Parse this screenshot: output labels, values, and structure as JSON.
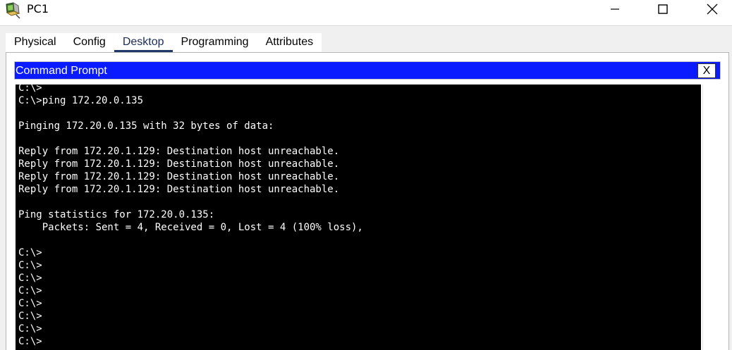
{
  "window": {
    "title": "PC1",
    "icon": "pc-app-icon",
    "controls": [
      "minimize-icon",
      "maximize-icon",
      "close-icon"
    ]
  },
  "tabs": [
    {
      "label": "Physical",
      "active": false
    },
    {
      "label": "Config",
      "active": false
    },
    {
      "label": "Desktop",
      "active": true
    },
    {
      "label": "Programming",
      "active": false
    },
    {
      "label": "Attributes",
      "active": false
    }
  ],
  "command_prompt": {
    "title": "Command Prompt",
    "close_label": "X",
    "header_color": "#0a1cff",
    "lines": [
      "C:\\>",
      "C:\\>ping 172.20.0.135",
      "",
      "Pinging 172.20.0.135 with 32 bytes of data:",
      "",
      "Reply from 172.20.1.129: Destination host unreachable.",
      "Reply from 172.20.1.129: Destination host unreachable.",
      "Reply from 172.20.1.129: Destination host unreachable.",
      "Reply from 172.20.1.129: Destination host unreachable.",
      "",
      "Ping statistics for 172.20.0.135:",
      "    Packets: Sent = 4, Received = 0, Lost = 4 (100% loss),",
      "",
      "C:\\>",
      "C:\\>",
      "C:\\>",
      "C:\\>",
      "C:\\>",
      "C:\\>",
      "C:\\>",
      "C:\\>"
    ]
  }
}
